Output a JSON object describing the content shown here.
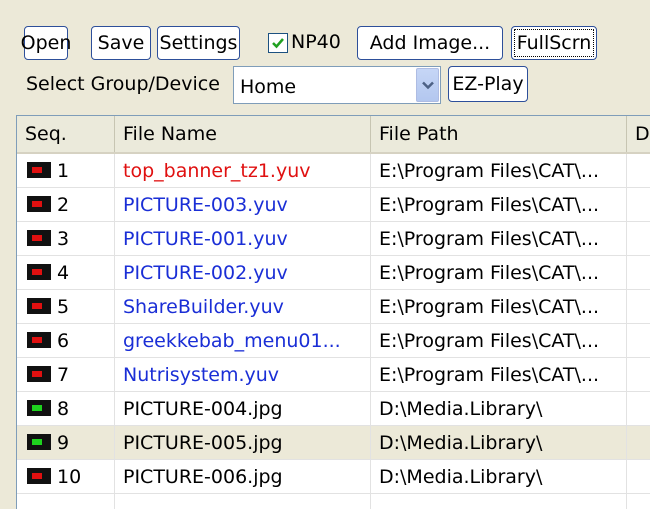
{
  "toolbar": {
    "open_label": "Open",
    "save_label": "Save",
    "settings_label": "Settings",
    "np40_label": "NP40",
    "np40_checked": true,
    "add_image_label": "Add Image...",
    "fullscreen_label": "FullScrn"
  },
  "group": {
    "label": "Select Group/Device",
    "selected": "Home",
    "ezplay_label": "EZ-Play"
  },
  "table": {
    "columns": [
      "Seq.",
      "File Name",
      "File Path",
      "D"
    ],
    "rows": [
      {
        "seq": "1",
        "name": "top_banner_tz1.yuv",
        "path": "E:\\Program Files\\CAT\\...",
        "lamp": "#e01010",
        "name_color": "#e01010"
      },
      {
        "seq": "2",
        "name": "PICTURE-003.yuv",
        "path": "E:\\Program Files\\CAT\\...",
        "lamp": "#e01010",
        "name_color": "#1a2ed6"
      },
      {
        "seq": "3",
        "name": "PICTURE-001.yuv",
        "path": "E:\\Program Files\\CAT\\...",
        "lamp": "#e01010",
        "name_color": "#1a2ed6"
      },
      {
        "seq": "4",
        "name": "PICTURE-002.yuv",
        "path": "E:\\Program Files\\CAT\\...",
        "lamp": "#e01010",
        "name_color": "#1a2ed6"
      },
      {
        "seq": "5",
        "name": "ShareBuilder.yuv",
        "path": "E:\\Program Files\\CAT\\...",
        "lamp": "#e01010",
        "name_color": "#1a2ed6"
      },
      {
        "seq": "6",
        "name": "greekkebab_menu01...",
        "path": "E:\\Program Files\\CAT\\...",
        "lamp": "#e01010",
        "name_color": "#1a2ed6"
      },
      {
        "seq": "7",
        "name": "Nutrisystem.yuv",
        "path": "E:\\Program Files\\CAT\\...",
        "lamp": "#e01010",
        "name_color": "#1a2ed6"
      },
      {
        "seq": "8",
        "name": "PICTURE-004.jpg",
        "path": "D:\\Media.Library\\",
        "lamp": "#1ed21e",
        "name_color": "#000000"
      },
      {
        "seq": "9",
        "name": "PICTURE-005.jpg",
        "path": "D:\\Media.Library\\",
        "lamp": "#1ed21e",
        "name_color": "#000000",
        "selected": true
      },
      {
        "seq": "10",
        "name": "PICTURE-006.jpg",
        "path": "D:\\Media.Library\\",
        "lamp": "#e01010",
        "name_color": "#000000"
      }
    ]
  }
}
